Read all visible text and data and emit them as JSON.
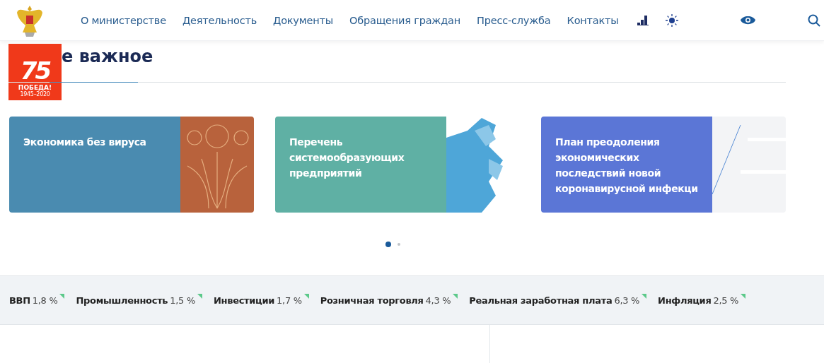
{
  "nav": {
    "items": [
      "О министерстве",
      "Деятельность",
      "Документы",
      "Обращения граждан",
      "Пресс-служба",
      "Контакты"
    ]
  },
  "badge": {
    "number": "75",
    "title": "ПОБЕДА!",
    "years": "1945–2020"
  },
  "section": {
    "title": "е важное"
  },
  "cards": [
    {
      "title": "Экономика без вируса",
      "color": "#4a8bb0",
      "kind": "emblem"
    },
    {
      "title": "Перечень системообразующих предприятий",
      "color": "#5fb0a4",
      "kind": "map"
    },
    {
      "title": "План преодоления экономических последствий новой коронавирусной инфекци",
      "color": "#5b76d6",
      "kind": "lines"
    }
  ],
  "dots": [
    {
      "selected": true
    },
    {
      "selected": false
    }
  ],
  "indicators": [
    {
      "name": "ВВП",
      "value": "1,8 %"
    },
    {
      "name": "Промышленность",
      "value": "1,5 %"
    },
    {
      "name": "Инвестиции",
      "value": "1,7 %"
    },
    {
      "name": "Розничная торговля",
      "value": "4,3 %"
    },
    {
      "name": "Реальная заработная плата",
      "value": "6,3 %"
    },
    {
      "name": "Инфляция",
      "value": "2,5 %"
    }
  ]
}
